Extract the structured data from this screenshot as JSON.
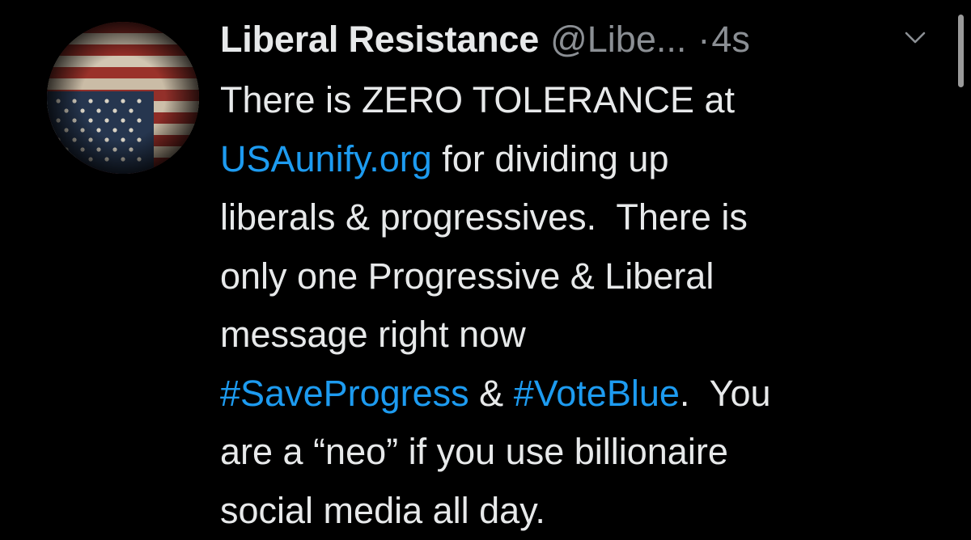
{
  "tweet": {
    "display_name": "Liberal Resistance",
    "handle": "@Libe...",
    "separator": "·",
    "time": "4s",
    "body": {
      "line1": "There is ZERO TOLERANCE at",
      "line2_link": "USAunify.org",
      "line2_rest": " for dividing up",
      "line3": "liberals & progressives.  There is",
      "line4": "only one Progressive & Liberal",
      "line5": "message right now",
      "line6_tag1": "#SaveProgress",
      "line6_mid": " & ",
      "line6_tag2": "#VoteBlue",
      "line6_rest": ".  You",
      "line7": "are a “neo” if you use billionaire",
      "line8": "social media all day."
    }
  },
  "icons": {
    "avatar": "upside-down-us-flag-avatar",
    "menu": "chevron-down-icon"
  },
  "colors": {
    "background": "#000000",
    "text": "#e7e9ea",
    "secondary": "#8b8f94",
    "link": "#1d9bf0"
  }
}
